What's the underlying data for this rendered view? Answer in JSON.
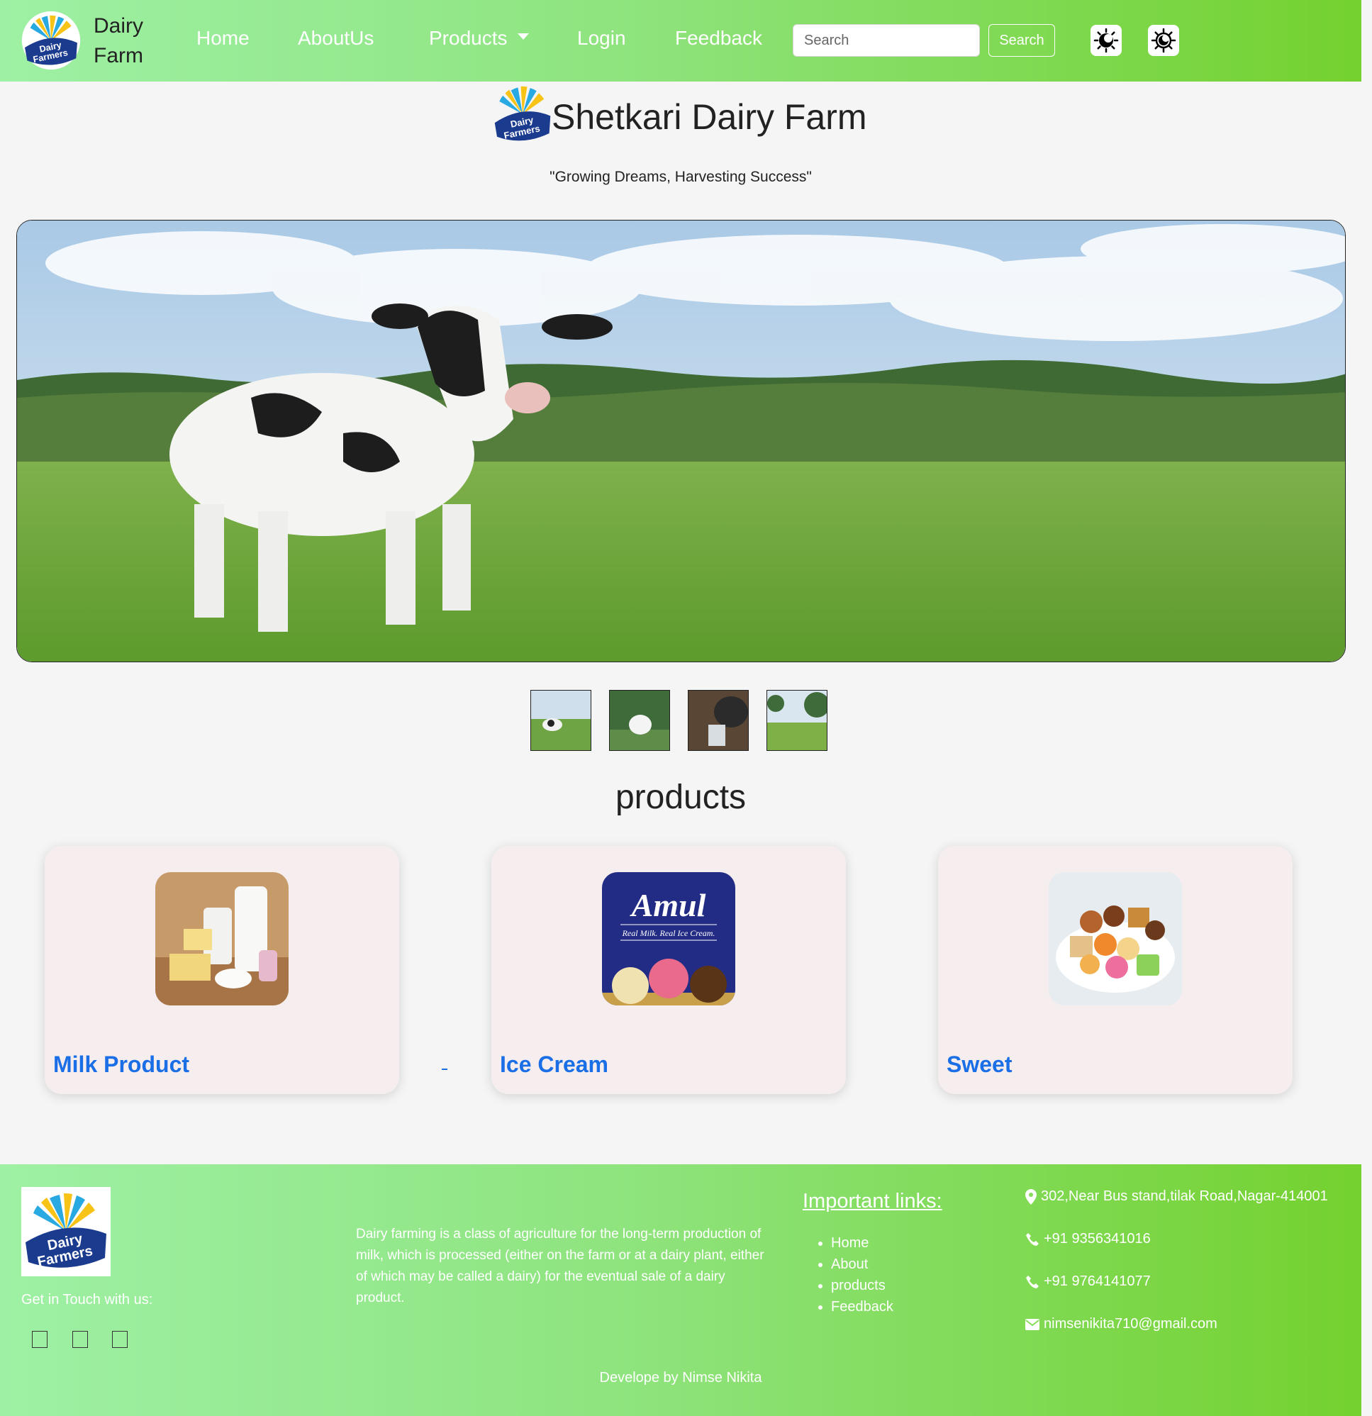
{
  "navbar": {
    "brand_line1": "Dairy",
    "brand_line2": "Farm",
    "logo_text_line1": "Dairy",
    "logo_text_line2": "Farmers",
    "links": [
      "Home",
      "AboutUs",
      "Products",
      "Login",
      "Feedback"
    ],
    "search_placeholder": "Search",
    "search_button": "Search",
    "theme_icons": [
      "theme-toggle-icon",
      "theme-toggle-icon"
    ]
  },
  "header": {
    "title": "Shetkari Dairy Farm",
    "tagline": "\"Growing Dreams, Harvesting Success\""
  },
  "carousel": {
    "thumbnail_count": 4,
    "slides": [
      "cow-in-field",
      "white-cow",
      "milking",
      "cows-grazing"
    ]
  },
  "products": {
    "heading": "products",
    "items": [
      {
        "title": "Milk Product",
        "image": "dairy-products-image"
      },
      {
        "title": "Ice Cream",
        "image": "amul-ice-cream-image",
        "image_brand": "Amul",
        "image_slogan": "Real Milk. Real Ice Cream."
      },
      {
        "title": "Sweet",
        "image": "sweets-plate-image"
      }
    ]
  },
  "footer": {
    "touch_label": "Get in Touch with us:",
    "about_text": "Dairy farming is a class of agriculture for the long-term production of milk, which is processed (either on the farm or at a dairy plant, either of which may be called a dairy) for the eventual sale of a dairy product.",
    "links_title": "Important links:",
    "links": [
      "Home",
      "About",
      "products",
      "Feedback"
    ],
    "address": "302,Near Bus stand,tilak Road,Nagar-414001",
    "phone1": "+91 9356341016",
    "phone2": "+91 9764141077",
    "email": "nimsenikita710@gmail.com",
    "credit": "Develope by Nimse Nikita"
  },
  "colors": {
    "nav_gradient_start": "#9ef0a4",
    "nav_gradient_end": "#74d12f",
    "card_bg": "#f6eeee",
    "link_blue": "#1a6ee6",
    "logo_navy": "#1b3b8f"
  }
}
